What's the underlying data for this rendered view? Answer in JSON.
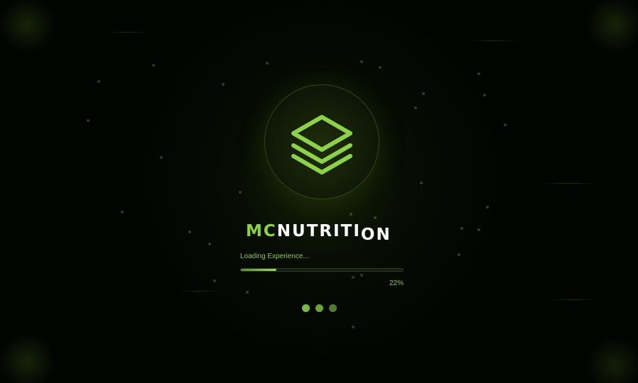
{
  "app": {
    "brand_prefix": "MC",
    "brand_main": "NUTRITI",
    "brand_drop": "ON",
    "logo_icon": "layers-icon"
  },
  "loader": {
    "status_text": "Loading Experience...",
    "progress": 0.22,
    "percent_label": "22%",
    "dots": [
      {
        "state": "active"
      },
      {
        "state": "mid"
      },
      {
        "state": "dim"
      }
    ]
  },
  "colors": {
    "accent": "#8dd14a",
    "accent_dark": "#5a8f2a",
    "text_white": "#ffffff",
    "background": "#020402",
    "dot_active": "#7ab84a",
    "dot_mid": "#6aa13f",
    "dot_dim": "#4f7d32"
  }
}
